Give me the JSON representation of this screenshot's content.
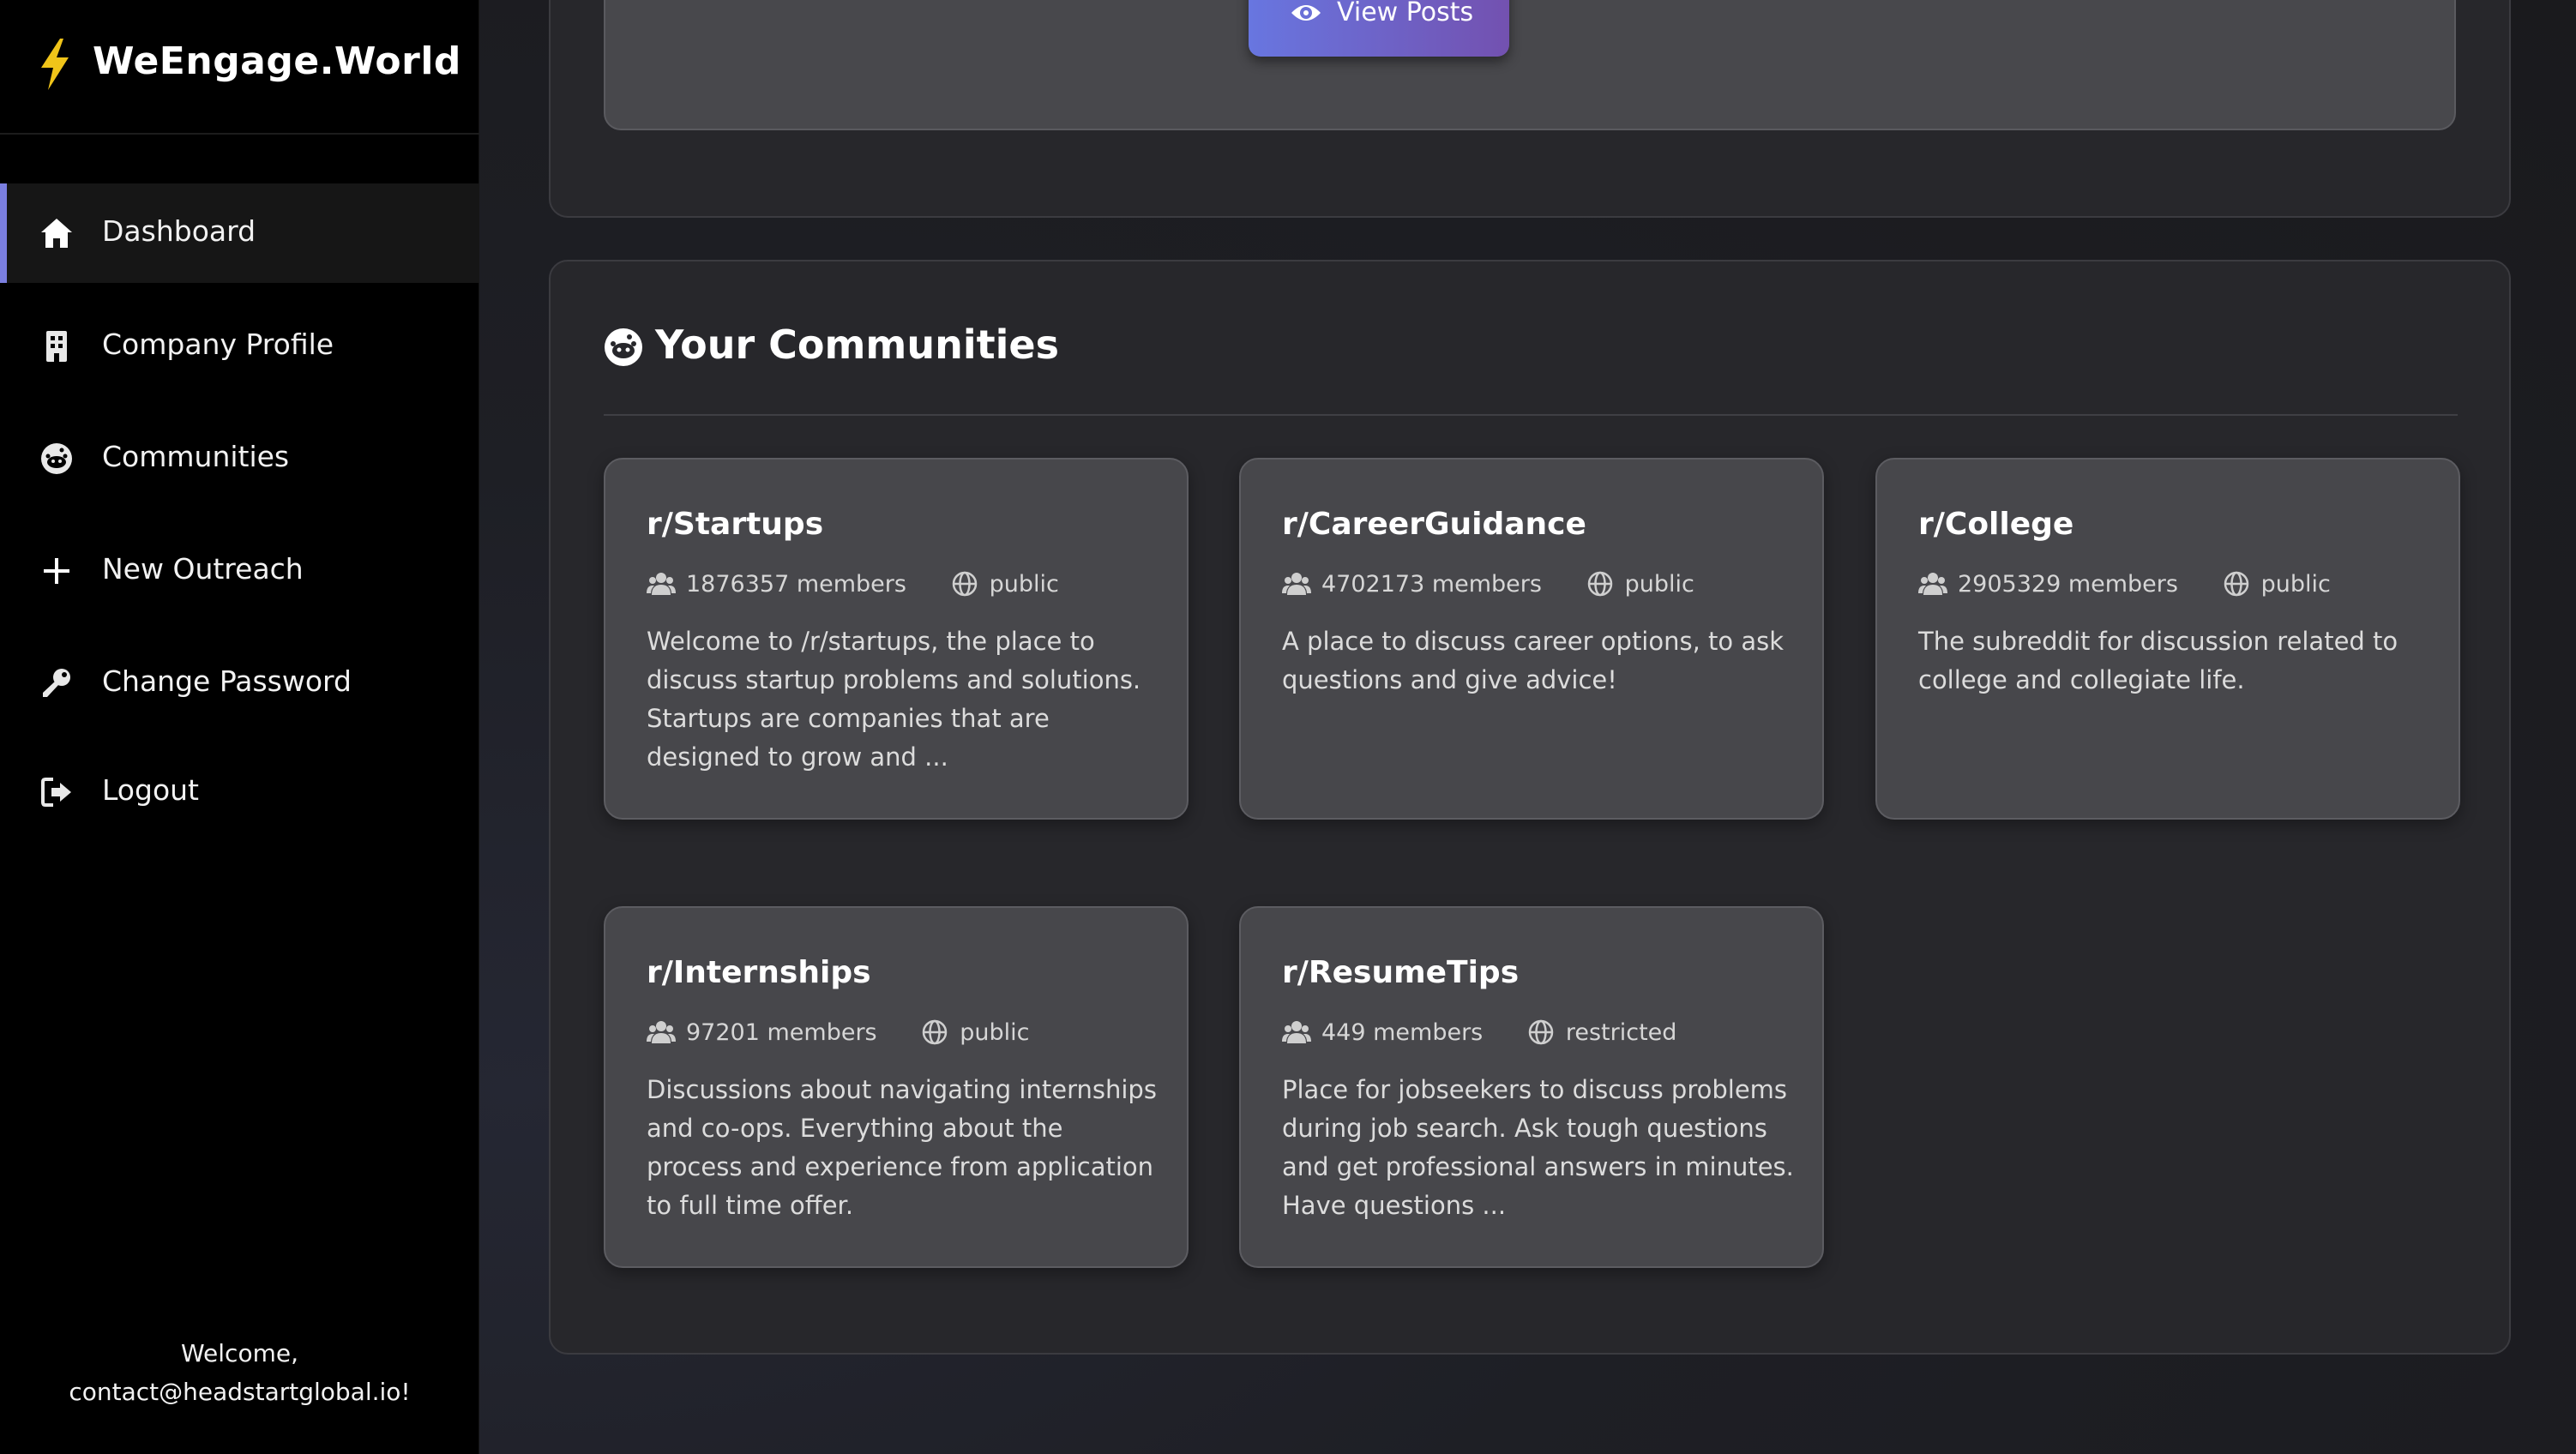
{
  "brand": {
    "name": "WeEngage.World",
    "icon": "lightning-bolt-icon"
  },
  "sidebar": {
    "items": [
      {
        "label": "Dashboard",
        "icon": "home-icon",
        "active": true
      },
      {
        "label": "Company Profile",
        "icon": "building-icon",
        "active": false
      },
      {
        "label": "Communities",
        "icon": "reddit-icon",
        "active": false
      },
      {
        "label": "New Outreach",
        "icon": "plus-icon",
        "active": false
      },
      {
        "label": "Change Password",
        "icon": "key-icon",
        "active": false
      },
      {
        "label": "Logout",
        "icon": "logout-icon",
        "active": false
      }
    ],
    "welcome_line1": "Welcome,",
    "welcome_line2": "contact@headstartglobal.io!"
  },
  "top_card": {
    "view_posts_label": "View Posts"
  },
  "communities": {
    "title": "Your Communities",
    "items": [
      {
        "name": "r/Startups",
        "members": "1876357 members",
        "type": "public",
        "description": "Welcome to /r/startups, the place to discuss startup problems and solutions. Startups are companies that are designed to grow and ..."
      },
      {
        "name": "r/CareerGuidance",
        "members": "4702173 members",
        "type": "public",
        "description": "A place to discuss career options, to ask questions and give advice!"
      },
      {
        "name": "r/College",
        "members": "2905329 members",
        "type": "public",
        "description": "The subreddit for discussion related to college and collegiate life."
      },
      {
        "name": "r/Internships",
        "members": "97201 members",
        "type": "public",
        "description": "Discussions about navigating internships and co-ops. Everything about the process and experience from application to full time offer."
      },
      {
        "name": "r/ResumeTips",
        "members": "449 members",
        "type": "restricted",
        "description": "Place for jobseekers to discuss problems during job search. Ask tough questions and get professional answers in minutes. Have questions ..."
      }
    ]
  },
  "colors": {
    "accent": "#7b7fe0",
    "button_start": "#6876e0",
    "button_end": "#7351b0",
    "sidebar_bg": "#000000"
  }
}
